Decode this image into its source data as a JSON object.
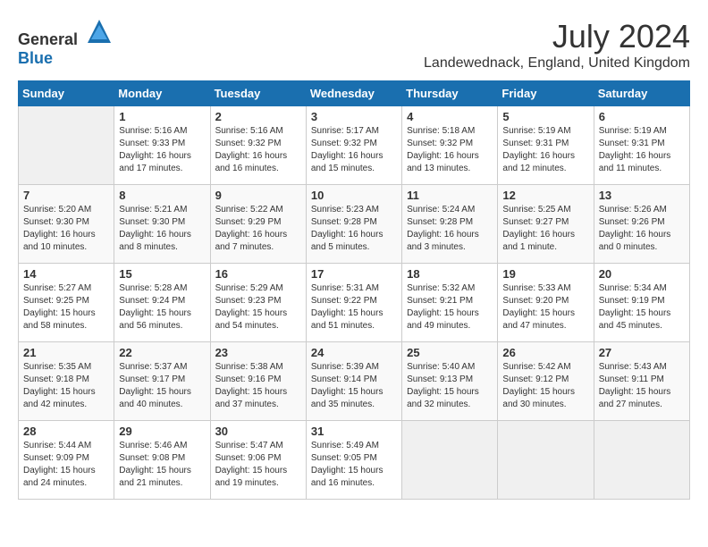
{
  "logo": {
    "text_general": "General",
    "text_blue": "Blue"
  },
  "title": "July 2024",
  "location": "Landewednack, England, United Kingdom",
  "days_of_week": [
    "Sunday",
    "Monday",
    "Tuesday",
    "Wednesday",
    "Thursday",
    "Friday",
    "Saturday"
  ],
  "weeks": [
    [
      {
        "day": "",
        "info": ""
      },
      {
        "day": "1",
        "info": "Sunrise: 5:16 AM\nSunset: 9:33 PM\nDaylight: 16 hours\nand 17 minutes."
      },
      {
        "day": "2",
        "info": "Sunrise: 5:16 AM\nSunset: 9:32 PM\nDaylight: 16 hours\nand 16 minutes."
      },
      {
        "day": "3",
        "info": "Sunrise: 5:17 AM\nSunset: 9:32 PM\nDaylight: 16 hours\nand 15 minutes."
      },
      {
        "day": "4",
        "info": "Sunrise: 5:18 AM\nSunset: 9:32 PM\nDaylight: 16 hours\nand 13 minutes."
      },
      {
        "day": "5",
        "info": "Sunrise: 5:19 AM\nSunset: 9:31 PM\nDaylight: 16 hours\nand 12 minutes."
      },
      {
        "day": "6",
        "info": "Sunrise: 5:19 AM\nSunset: 9:31 PM\nDaylight: 16 hours\nand 11 minutes."
      }
    ],
    [
      {
        "day": "7",
        "info": "Sunrise: 5:20 AM\nSunset: 9:30 PM\nDaylight: 16 hours\nand 10 minutes."
      },
      {
        "day": "8",
        "info": "Sunrise: 5:21 AM\nSunset: 9:30 PM\nDaylight: 16 hours\nand 8 minutes."
      },
      {
        "day": "9",
        "info": "Sunrise: 5:22 AM\nSunset: 9:29 PM\nDaylight: 16 hours\nand 7 minutes."
      },
      {
        "day": "10",
        "info": "Sunrise: 5:23 AM\nSunset: 9:28 PM\nDaylight: 16 hours\nand 5 minutes."
      },
      {
        "day": "11",
        "info": "Sunrise: 5:24 AM\nSunset: 9:28 PM\nDaylight: 16 hours\nand 3 minutes."
      },
      {
        "day": "12",
        "info": "Sunrise: 5:25 AM\nSunset: 9:27 PM\nDaylight: 16 hours\nand 1 minute."
      },
      {
        "day": "13",
        "info": "Sunrise: 5:26 AM\nSunset: 9:26 PM\nDaylight: 16 hours\nand 0 minutes."
      }
    ],
    [
      {
        "day": "14",
        "info": "Sunrise: 5:27 AM\nSunset: 9:25 PM\nDaylight: 15 hours\nand 58 minutes."
      },
      {
        "day": "15",
        "info": "Sunrise: 5:28 AM\nSunset: 9:24 PM\nDaylight: 15 hours\nand 56 minutes."
      },
      {
        "day": "16",
        "info": "Sunrise: 5:29 AM\nSunset: 9:23 PM\nDaylight: 15 hours\nand 54 minutes."
      },
      {
        "day": "17",
        "info": "Sunrise: 5:31 AM\nSunset: 9:22 PM\nDaylight: 15 hours\nand 51 minutes."
      },
      {
        "day": "18",
        "info": "Sunrise: 5:32 AM\nSunset: 9:21 PM\nDaylight: 15 hours\nand 49 minutes."
      },
      {
        "day": "19",
        "info": "Sunrise: 5:33 AM\nSunset: 9:20 PM\nDaylight: 15 hours\nand 47 minutes."
      },
      {
        "day": "20",
        "info": "Sunrise: 5:34 AM\nSunset: 9:19 PM\nDaylight: 15 hours\nand 45 minutes."
      }
    ],
    [
      {
        "day": "21",
        "info": "Sunrise: 5:35 AM\nSunset: 9:18 PM\nDaylight: 15 hours\nand 42 minutes."
      },
      {
        "day": "22",
        "info": "Sunrise: 5:37 AM\nSunset: 9:17 PM\nDaylight: 15 hours\nand 40 minutes."
      },
      {
        "day": "23",
        "info": "Sunrise: 5:38 AM\nSunset: 9:16 PM\nDaylight: 15 hours\nand 37 minutes."
      },
      {
        "day": "24",
        "info": "Sunrise: 5:39 AM\nSunset: 9:14 PM\nDaylight: 15 hours\nand 35 minutes."
      },
      {
        "day": "25",
        "info": "Sunrise: 5:40 AM\nSunset: 9:13 PM\nDaylight: 15 hours\nand 32 minutes."
      },
      {
        "day": "26",
        "info": "Sunrise: 5:42 AM\nSunset: 9:12 PM\nDaylight: 15 hours\nand 30 minutes."
      },
      {
        "day": "27",
        "info": "Sunrise: 5:43 AM\nSunset: 9:11 PM\nDaylight: 15 hours\nand 27 minutes."
      }
    ],
    [
      {
        "day": "28",
        "info": "Sunrise: 5:44 AM\nSunset: 9:09 PM\nDaylight: 15 hours\nand 24 minutes."
      },
      {
        "day": "29",
        "info": "Sunrise: 5:46 AM\nSunset: 9:08 PM\nDaylight: 15 hours\nand 21 minutes."
      },
      {
        "day": "30",
        "info": "Sunrise: 5:47 AM\nSunset: 9:06 PM\nDaylight: 15 hours\nand 19 minutes."
      },
      {
        "day": "31",
        "info": "Sunrise: 5:49 AM\nSunset: 9:05 PM\nDaylight: 15 hours\nand 16 minutes."
      },
      {
        "day": "",
        "info": ""
      },
      {
        "day": "",
        "info": ""
      },
      {
        "day": "",
        "info": ""
      }
    ]
  ]
}
